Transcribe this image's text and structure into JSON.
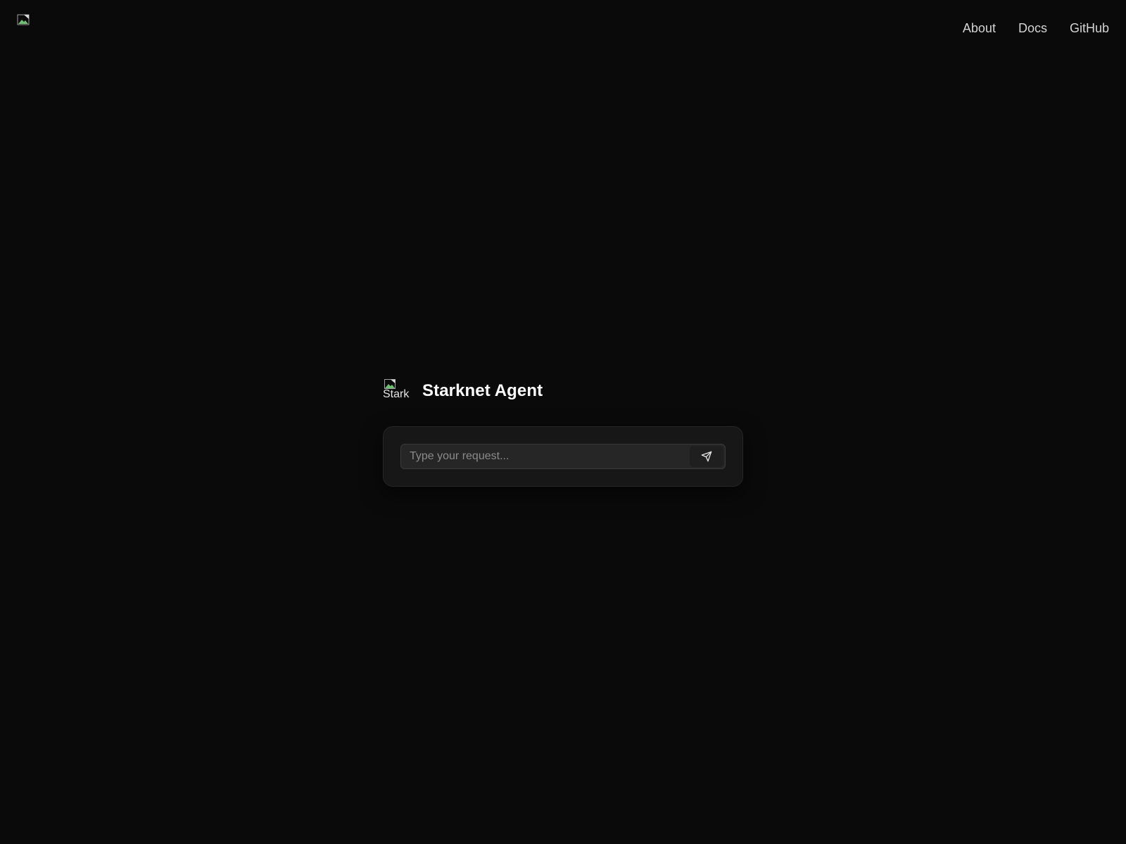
{
  "header": {
    "logo_icon": "broken-image-icon",
    "nav": [
      {
        "label": "About"
      },
      {
        "label": "Docs"
      },
      {
        "label": "GitHub"
      }
    ]
  },
  "hero": {
    "image_alt": "Stark",
    "image_icon": "broken-image-icon",
    "title": "Starknet Agent"
  },
  "prompt": {
    "placeholder": "Type your request...",
    "value": "",
    "send_icon": "send-icon"
  },
  "colors": {
    "background": "#0a0a0a",
    "card": "#171717",
    "input": "#262626",
    "text": "#ffffff",
    "nav_text": "#d4d4d4",
    "placeholder": "#8a8a8a"
  }
}
